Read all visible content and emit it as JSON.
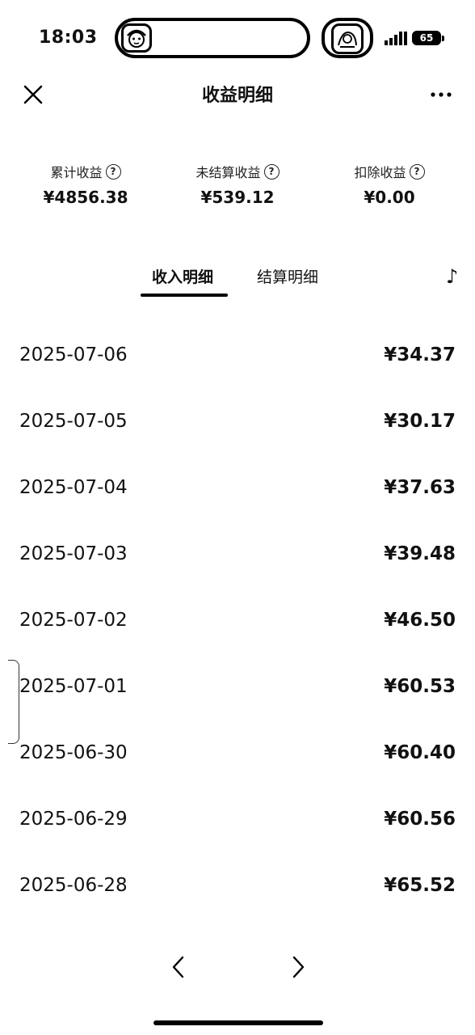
{
  "status_bar": {
    "time": "18:03",
    "battery": "65"
  },
  "header": {
    "title": "收益明细",
    "close_icon": "close-icon",
    "more_icon": "more-icon"
  },
  "summary": [
    {
      "label": "累计收益",
      "value": "¥4856.38"
    },
    {
      "label": "未结算收益",
      "value": "¥539.12"
    },
    {
      "label": "扣除收益",
      "value": "¥0.00"
    }
  ],
  "help_glyph": "?",
  "tabs": [
    {
      "label": "收入明细",
      "active": true
    },
    {
      "label": "结算明细",
      "active": false
    }
  ],
  "music_glyph": "♪",
  "income_rows": [
    {
      "date": "2025-07-06",
      "amount": "¥34.37"
    },
    {
      "date": "2025-07-05",
      "amount": "¥30.17"
    },
    {
      "date": "2025-07-04",
      "amount": "¥37.63"
    },
    {
      "date": "2025-07-03",
      "amount": "¥39.48"
    },
    {
      "date": "2025-07-02",
      "amount": "¥46.50"
    },
    {
      "date": "2025-07-01",
      "amount": "¥60.53"
    },
    {
      "date": "2025-06-30",
      "amount": "¥60.40"
    },
    {
      "date": "2025-06-29",
      "amount": "¥60.56"
    },
    {
      "date": "2025-06-28",
      "amount": "¥65.52"
    }
  ],
  "pager": {
    "prev_icon": "chevron-left-icon",
    "next_icon": "chevron-right-icon"
  }
}
